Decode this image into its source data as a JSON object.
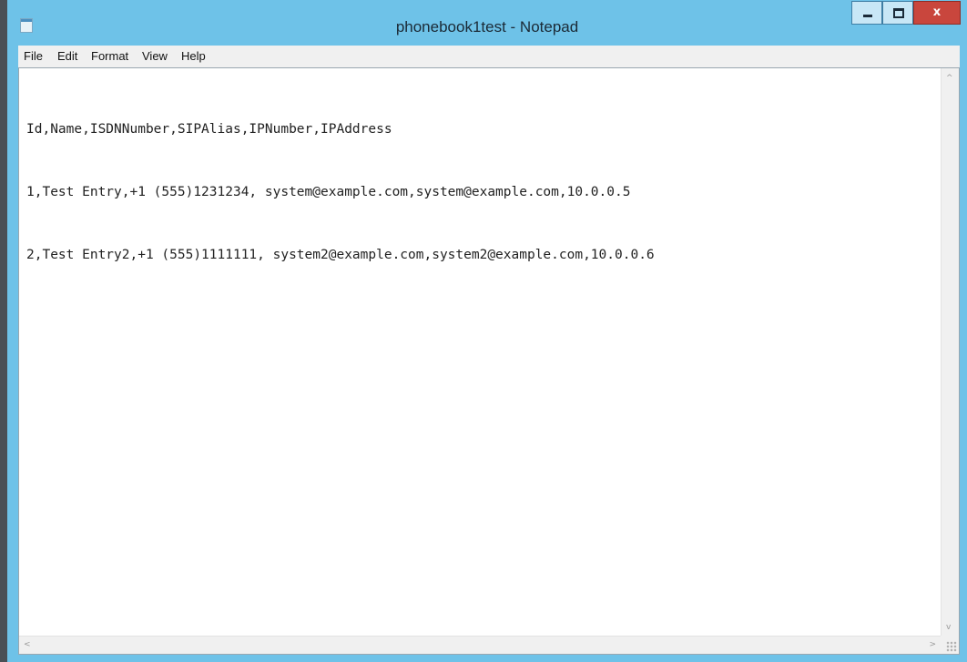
{
  "window": {
    "title": "phonebook1test - Notepad",
    "icons": {
      "app": "notepad-icon",
      "minimize": "minimize-icon",
      "maximize": "maximize-icon",
      "close": "close-icon"
    },
    "close_glyph": "x",
    "accent_color": "#6ec2e8",
    "close_color": "#c9463d"
  },
  "menu": {
    "items": [
      "File",
      "Edit",
      "Format",
      "View",
      "Help"
    ]
  },
  "editor": {
    "lines": [
      "Id,Name,ISDNNumber,SIPAlias,IPNumber,IPAddress",
      "1,Test Entry,+1 (555)1231234, system@example.com,system@example.com,10.0.0.5",
      "2,Test Entry2,+1 (555)1111111, system2@example.com,system2@example.com,10.0.0.6"
    ]
  },
  "scrollbars": {
    "up_arrow": "^",
    "down_arrow": "v",
    "left_arrow": "<",
    "right_arrow": ">"
  }
}
